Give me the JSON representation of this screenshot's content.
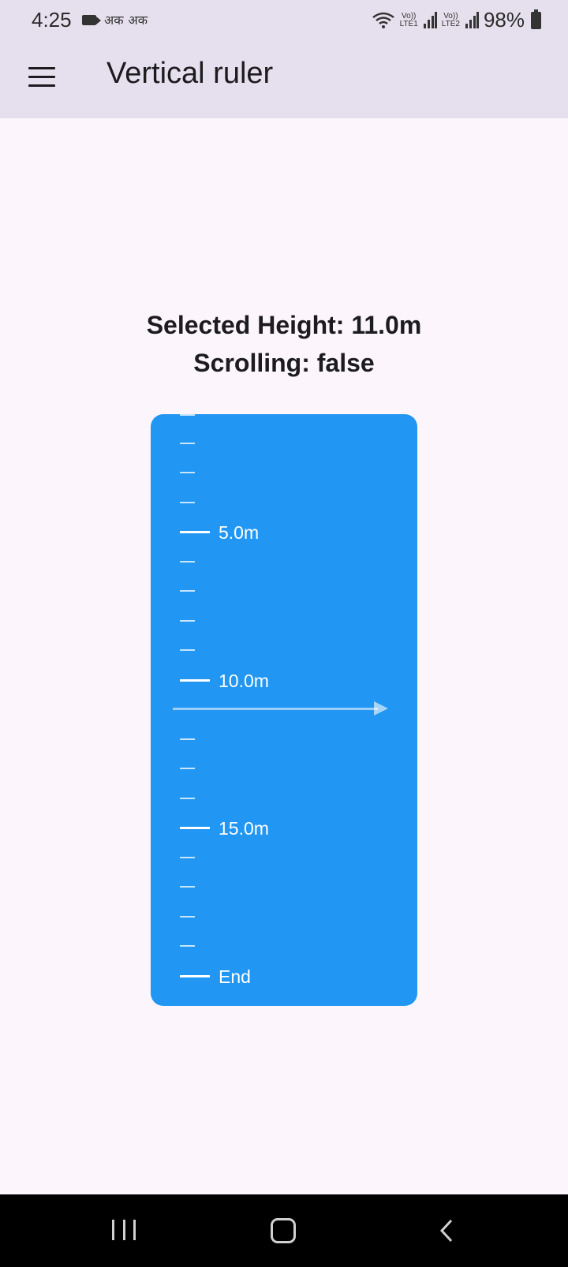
{
  "status_bar": {
    "time": "4:25",
    "indic_glyph_1": "अक",
    "indic_glyph_2": "अक",
    "sim1_label_top": "Vo))",
    "sim1_label_bottom": "LTE1",
    "sim2_label_top": "Vo))",
    "sim2_label_bottom": "LTE2",
    "battery": "98%"
  },
  "app_bar": {
    "title": "Vertical ruler"
  },
  "info": {
    "selected_height": "Selected Height: 11.0m",
    "scrolling": "Scrolling: false"
  },
  "ruler": {
    "label_5": "5.0m",
    "label_10": "10.0m",
    "label_15": "15.0m",
    "label_end": "End",
    "selected_value": 11.0,
    "colors": {
      "background": "#2196f3",
      "tick": "#ffffff"
    }
  }
}
